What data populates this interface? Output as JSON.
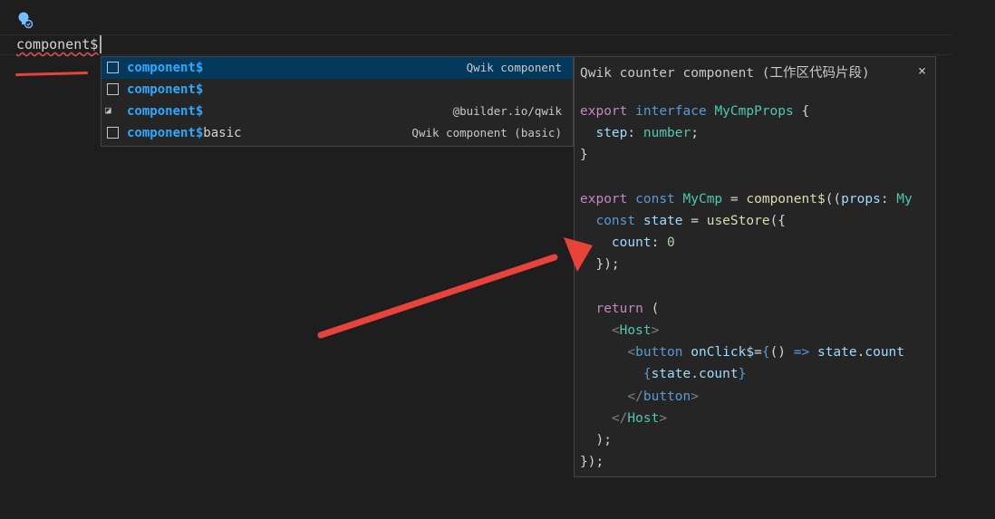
{
  "editor": {
    "typed_text": "component$"
  },
  "suggestions": [
    {
      "highlight": "component$",
      "rest": "",
      "detail": "Qwik component",
      "icon": "snippet-icon",
      "selected": true
    },
    {
      "highlight": "component$",
      "rest": "",
      "detail": "",
      "icon": "snippet-icon",
      "selected": false
    },
    {
      "highlight": "component$",
      "rest": "",
      "detail": "@builder.io/qwik",
      "icon": "reference-icon",
      "selected": false
    },
    {
      "highlight": "component$",
      "rest": "basic",
      "detail": "Qwik component (basic)",
      "icon": "snippet-icon",
      "selected": false
    }
  ],
  "details": {
    "title": "Qwik counter component (工作区代码片段)",
    "close_symbol": "×",
    "code_lines": [
      "export interface MyCmpProps {",
      "  step: number;",
      "}",
      "",
      "export const MyCmp = component$((props: My",
      "  const state = useStore({",
      "    count: 0",
      "  });",
      "",
      "  return (",
      "    <Host>",
      "      <button onClick$={() => state.count",
      "        {state.count}",
      "      </button>",
      "    </Host>",
      "  );",
      "});"
    ]
  },
  "colors": {
    "background": "#1e1e1e",
    "panel": "#252526",
    "selected_row": "#04395e",
    "match_highlight": "#2aaaff",
    "annotation_red": "#e8433b"
  }
}
